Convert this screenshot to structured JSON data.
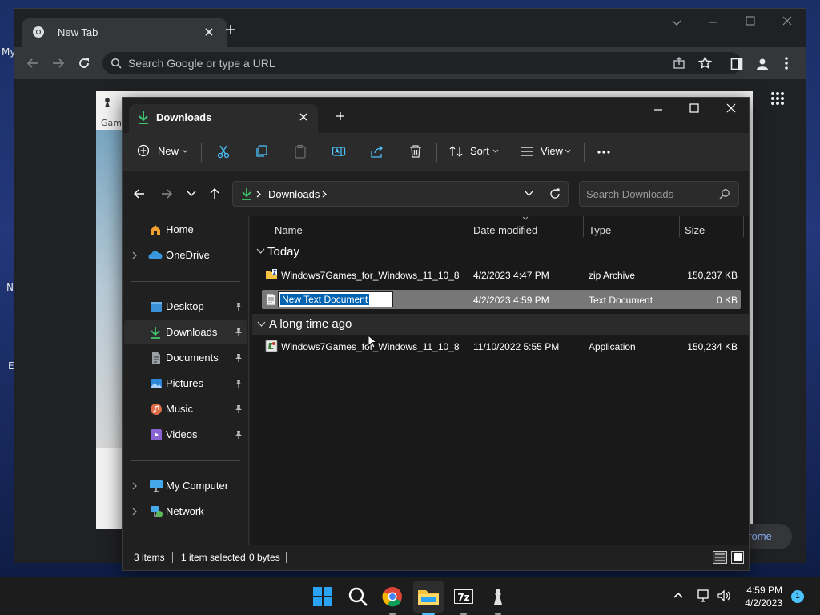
{
  "desktop": {
    "fragments": [
      "My",
      "N",
      "E"
    ]
  },
  "chrome": {
    "tab_title": "New Tab",
    "omnibox_placeholder": "Search Google or type a URL",
    "game_window_label": "Gam",
    "pill_label": "hrome"
  },
  "explorer": {
    "tab_title": "Downloads",
    "commands": {
      "new_label": "New",
      "sort_label": "Sort",
      "view_label": "View"
    },
    "address": {
      "crumb": "Downloads"
    },
    "search_placeholder": "Search Downloads",
    "nav": {
      "home": "Home",
      "onedrive": "OneDrive",
      "desktop": "Desktop",
      "downloads": "Downloads",
      "documents": "Documents",
      "pictures": "Pictures",
      "music": "Music",
      "videos": "Videos",
      "my_computer": "My Computer",
      "network": "Network"
    },
    "columns": {
      "name": "Name",
      "date": "Date modified",
      "type": "Type",
      "size": "Size"
    },
    "groups": {
      "today": "Today",
      "older": "A long time ago"
    },
    "files": [
      {
        "name": "Windows7Games_for_Windows_11_10_8",
        "date": "4/2/2023 4:47 PM",
        "type": "zip Archive",
        "size": "150,237 KB"
      },
      {
        "name": "New Text Document",
        "date": "4/2/2023 4:59 PM",
        "type": "Text Document",
        "size": "0 KB"
      },
      {
        "name": "Windows7Games_for_Windows_11_10_8",
        "date": "11/10/2022 5:55 PM",
        "type": "Application",
        "size": "150,234 KB"
      }
    ],
    "status": {
      "items": "3 items",
      "selected": "1 item selected",
      "size": "0 bytes"
    }
  },
  "taskbar": {
    "time": "4:59 PM",
    "date": "4/2/2023",
    "notification_count": "1"
  },
  "colors": {
    "accent": "#0063b1",
    "downloads_green": "#3ec46d",
    "selection_gray": "#777777",
    "taskbar_indicator": "#4cc2ff"
  }
}
